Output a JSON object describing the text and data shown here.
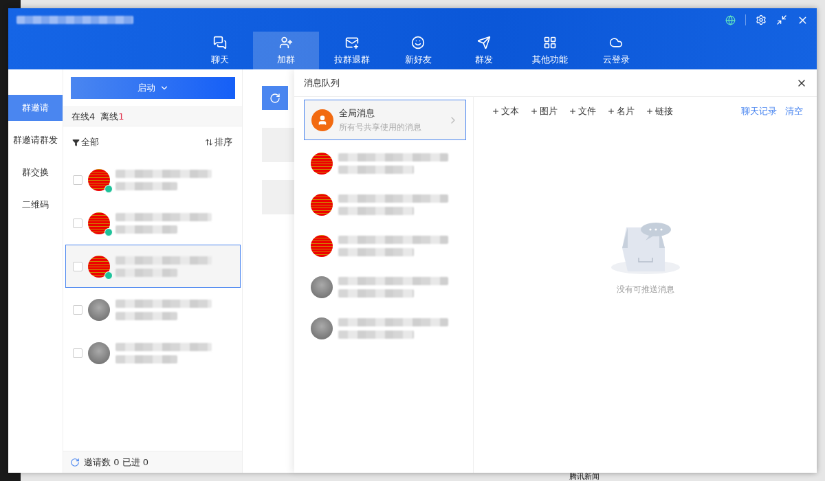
{
  "background": {
    "news_label": "腾讯新闻"
  },
  "window": {
    "nav": [
      {
        "label": "聊天",
        "kind": "chat",
        "selected": false
      },
      {
        "label": "加群",
        "kind": "join",
        "selected": true
      },
      {
        "label": "拉群退群",
        "kind": "pull",
        "selected": false
      },
      {
        "label": "新好友",
        "kind": "friend",
        "selected": false
      },
      {
        "label": "群发",
        "kind": "send",
        "selected": false
      },
      {
        "label": "其他功能",
        "kind": "apps",
        "selected": false
      },
      {
        "label": "云登录",
        "kind": "cloud",
        "selected": false
      }
    ]
  },
  "sidebar": {
    "items": [
      {
        "label": "群邀请",
        "selected": true
      },
      {
        "label": "群邀请群发",
        "selected": false
      },
      {
        "label": "群交换",
        "selected": false
      },
      {
        "label": "二维码",
        "selected": false
      }
    ]
  },
  "group_panel": {
    "start_button": "启动",
    "online_label": "在线",
    "online_count": "4",
    "offline_label": "离线",
    "offline_count": "1",
    "filter": "全部",
    "sort": "排序",
    "rows": [
      {
        "kind": "poster",
        "online": true,
        "checked": false,
        "selected": false
      },
      {
        "kind": "poster",
        "online": true,
        "checked": false,
        "selected": false
      },
      {
        "kind": "poster",
        "online": true,
        "checked": false,
        "selected": true
      },
      {
        "kind": "photo",
        "online": false,
        "checked": false,
        "selected": false
      },
      {
        "kind": "photo",
        "online": false,
        "checked": false,
        "selected": false
      }
    ],
    "footer": {
      "invites_label": "邀请数",
      "invites": "0",
      "joined_label": "已进",
      "joined": "0"
    }
  },
  "queue": {
    "title": "消息队列",
    "global": {
      "title": "全局消息",
      "subtitle": "所有号共享使用的消息",
      "selected": true
    },
    "accounts": [
      {
        "kind": "poster"
      },
      {
        "kind": "poster"
      },
      {
        "kind": "poster"
      },
      {
        "kind": "photo"
      },
      {
        "kind": "photo"
      }
    ],
    "actions": [
      "文本",
      "图片",
      "文件",
      "名片",
      "链接"
    ],
    "links": [
      "聊天记录",
      "清空"
    ],
    "empty": "没有可推送消息"
  }
}
